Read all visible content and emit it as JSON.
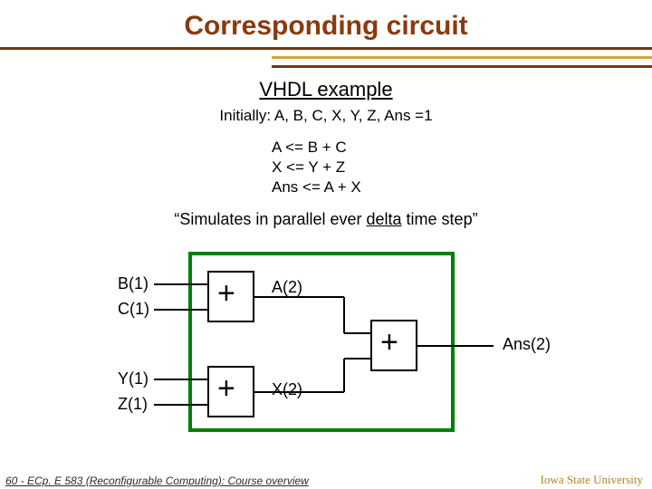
{
  "title": "Corresponding circuit",
  "subtitle": "VHDL example",
  "initially": "Initially: A, B, C, X, Y, Z, Ans =1",
  "code": {
    "l1": "A <= B + C",
    "l2": "X <= Y + Z",
    "l3": "Ans <= A + X"
  },
  "quote": {
    "pre": "“Simulates in parallel ever ",
    "u": "delta",
    "post": " time step”"
  },
  "inputs": {
    "b": "B(1)",
    "c": "C(1)",
    "y": "Y(1)",
    "z": "Z(1)"
  },
  "mids": {
    "a": "A(2)",
    "x": "X(2)"
  },
  "output": "Ans(2)",
  "op": "+",
  "footer": {
    "left": "60 - ECp. E 583 (Reconfigurable Computing): Course overview",
    "right": "Iowa State University"
  },
  "colors": {
    "title": "#8B3A0E",
    "ruleDark": "#7a3600",
    "ruleGold": "#d5a33a",
    "boxStroke": "#008000"
  }
}
